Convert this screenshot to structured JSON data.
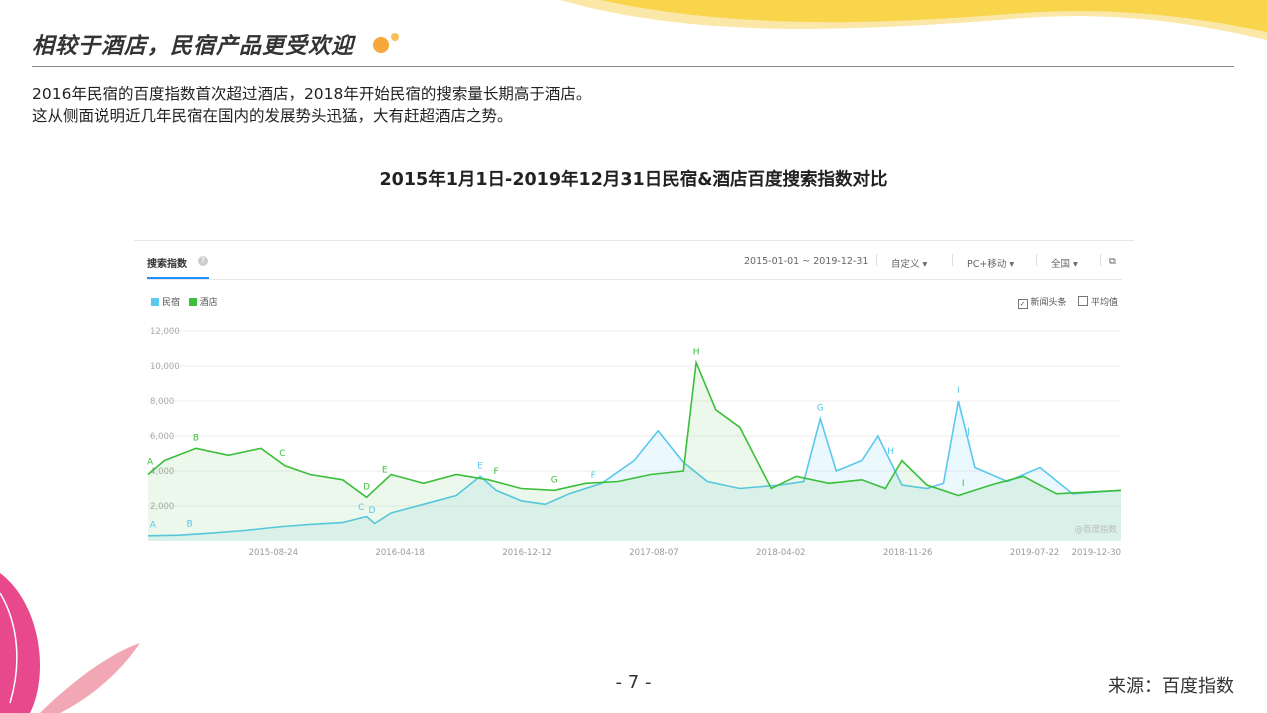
{
  "slide": {
    "title": "相较于酒店，民宿产品更受欢迎",
    "paragraph_1": "2016年民宿的百度指数首次超过酒店，2018年开始民宿的搜索量长期高于酒店。",
    "paragraph_2": "这从侧面说明近几年民宿在国内的发展势头迅猛，大有赶超酒店之势。",
    "chart_heading": "2015年1月1日-2019年12月31日民宿&酒店百度搜索指数对比",
    "page_number": "- 7 -",
    "source": "来源：百度指数"
  },
  "panel": {
    "tab_label": "搜索指数",
    "date_range": "2015-01-01 ~ 2019-12-31",
    "custom": "自定义",
    "device": "PC+移动",
    "region": "全国",
    "option_news": "新闻头条",
    "option_avg": "平均值",
    "watermark": "@百度指数"
  },
  "colors": {
    "minsu": "#5bc8ee",
    "hotel": "#3bbf3b",
    "accent_yellow": "#f8d54a",
    "accent_pink": "#e8498c"
  },
  "chart_data": {
    "type": "line",
    "x_range": [
      "2015-01-01",
      "2019-12-31"
    ],
    "x_ticks": [
      "2015-08-24",
      "2016-04-18",
      "2016-12-12",
      "2017-08-07",
      "2018-04-02",
      "2018-11-26",
      "2019-07-22",
      "2019-12-30"
    ],
    "y_ticks": [
      "2,000",
      "4,000",
      "6,000",
      "8,000",
      "10,000",
      "12,000"
    ],
    "ylim": [
      0,
      12000
    ],
    "grid": true,
    "legend": "top-left",
    "series": [
      {
        "name": "民宿",
        "color": "#5bc8ee",
        "points": [
          [
            "2015-01-01",
            300
          ],
          [
            "2015-03-01",
            330
          ],
          [
            "2015-05-01",
            450
          ],
          [
            "2015-07-01",
            600
          ],
          [
            "2015-09-01",
            800
          ],
          [
            "2015-11-01",
            950
          ],
          [
            "2016-01-01",
            1050
          ],
          [
            "2016-02-15",
            1400
          ],
          [
            "2016-03-01",
            1000
          ],
          [
            "2016-04-01",
            1600
          ],
          [
            "2016-06-01",
            2100
          ],
          [
            "2016-08-01",
            2600
          ],
          [
            "2016-09-15",
            3700
          ],
          [
            "2016-10-15",
            2900
          ],
          [
            "2016-12-01",
            2300
          ],
          [
            "2017-01-15",
            2100
          ],
          [
            "2017-03-01",
            2700
          ],
          [
            "2017-05-01",
            3300
          ],
          [
            "2017-07-01",
            4600
          ],
          [
            "2017-08-15",
            6300
          ],
          [
            "2017-10-01",
            4500
          ],
          [
            "2017-11-15",
            3400
          ],
          [
            "2018-01-15",
            3000
          ],
          [
            "2018-04-01",
            3200
          ],
          [
            "2018-05-15",
            3400
          ],
          [
            "2018-06-15",
            7000
          ],
          [
            "2018-07-15",
            4000
          ],
          [
            "2018-09-01",
            4600
          ],
          [
            "2018-10-01",
            6000
          ],
          [
            "2018-11-15",
            3200
          ],
          [
            "2019-01-01",
            3000
          ],
          [
            "2019-02-01",
            3300
          ],
          [
            "2019-03-01",
            8000
          ],
          [
            "2019-04-01",
            4200
          ],
          [
            "2019-06-01",
            3400
          ],
          [
            "2019-08-01",
            4200
          ],
          [
            "2019-10-01",
            2700
          ],
          [
            "2019-12-31",
            2900
          ]
        ]
      },
      {
        "name": "酒店",
        "color": "#3bbf3b",
        "points": [
          [
            "2015-01-01",
            3800
          ],
          [
            "2015-02-01",
            4600
          ],
          [
            "2015-04-01",
            5300
          ],
          [
            "2015-06-01",
            4900
          ],
          [
            "2015-08-01",
            5300
          ],
          [
            "2015-09-15",
            4300
          ],
          [
            "2015-11-01",
            3800
          ],
          [
            "2016-01-01",
            3500
          ],
          [
            "2016-02-15",
            2500
          ],
          [
            "2016-04-01",
            3800
          ],
          [
            "2016-06-01",
            3300
          ],
          [
            "2016-08-01",
            3800
          ],
          [
            "2016-10-01",
            3500
          ],
          [
            "2016-12-01",
            3000
          ],
          [
            "2017-02-01",
            2900
          ],
          [
            "2017-04-01",
            3300
          ],
          [
            "2017-06-01",
            3400
          ],
          [
            "2017-08-01",
            3800
          ],
          [
            "2017-10-01",
            4000
          ],
          [
            "2017-10-25",
            10200
          ],
          [
            "2017-12-01",
            7500
          ],
          [
            "2018-01-15",
            6500
          ],
          [
            "2018-03-15",
            3000
          ],
          [
            "2018-05-01",
            3700
          ],
          [
            "2018-07-01",
            3300
          ],
          [
            "2018-09-01",
            3500
          ],
          [
            "2018-10-15",
            3000
          ],
          [
            "2018-11-15",
            4600
          ],
          [
            "2019-01-01",
            3200
          ],
          [
            "2019-03-01",
            2600
          ],
          [
            "2019-05-01",
            3200
          ],
          [
            "2019-07-01",
            3700
          ],
          [
            "2019-09-01",
            2700
          ],
          [
            "2019-12-31",
            2900
          ]
        ]
      }
    ],
    "annotations": [
      {
        "label": "A",
        "series": "民宿",
        "date": "2015-01-10"
      },
      {
        "label": "B",
        "series": "民宿",
        "date": "2015-03-20"
      },
      {
        "label": "C",
        "series": "民宿",
        "date": "2016-02-05"
      },
      {
        "label": "D",
        "series": "民宿",
        "date": "2016-02-25"
      },
      {
        "label": "E",
        "series": "民宿",
        "date": "2016-09-15"
      },
      {
        "label": "F",
        "series": "民宿",
        "date": "2017-04-15"
      },
      {
        "label": "G",
        "series": "民宿",
        "date": "2018-06-15"
      },
      {
        "label": "H",
        "series": "民宿",
        "date": "2018-10-25"
      },
      {
        "label": "I",
        "series": "民宿",
        "date": "2019-03-01"
      },
      {
        "label": "J",
        "series": "民宿",
        "date": "2019-03-20"
      },
      {
        "label": "A",
        "series": "酒店",
        "date": "2015-01-05"
      },
      {
        "label": "B",
        "series": "酒店",
        "date": "2015-04-01"
      },
      {
        "label": "C",
        "series": "酒店",
        "date": "2015-09-10"
      },
      {
        "label": "D",
        "series": "酒店",
        "date": "2016-02-15"
      },
      {
        "label": "E",
        "series": "酒店",
        "date": "2016-03-20"
      },
      {
        "label": "F",
        "series": "酒店",
        "date": "2016-10-15"
      },
      {
        "label": "G",
        "series": "酒店",
        "date": "2017-02-01"
      },
      {
        "label": "H",
        "series": "酒店",
        "date": "2017-10-25"
      },
      {
        "label": "I",
        "series": "酒店",
        "date": "2019-03-10"
      }
    ]
  }
}
